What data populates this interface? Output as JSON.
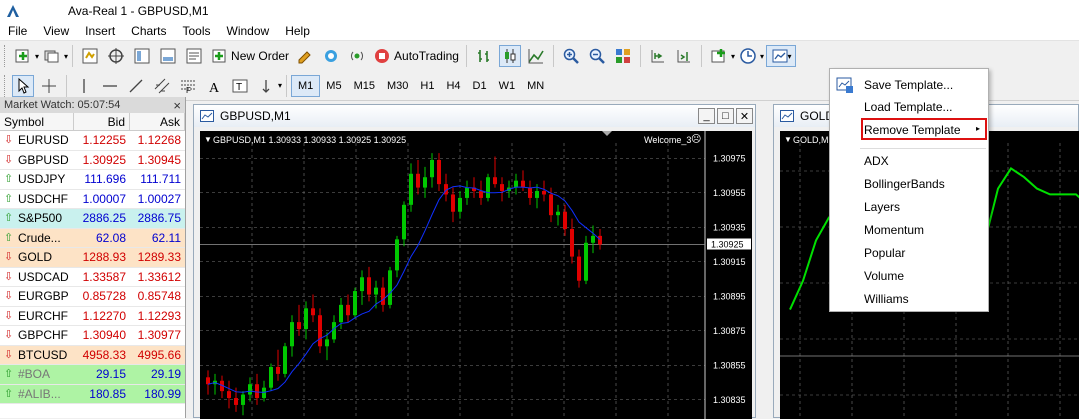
{
  "window": {
    "title": "Ava-Real 1 - GBPUSD,M1"
  },
  "menu": [
    "File",
    "View",
    "Insert",
    "Charts",
    "Tools",
    "Window",
    "Help"
  ],
  "toolbar": {
    "new_order": "New Order",
    "autotrading": "AutoTrading"
  },
  "timeframes": [
    "M1",
    "M5",
    "M15",
    "M30",
    "H1",
    "H4",
    "D1",
    "W1",
    "MN"
  ],
  "market_watch": {
    "title": "Market Watch: 05:07:54",
    "close": "×",
    "columns": [
      "Symbol",
      "Bid",
      "Ask"
    ],
    "rows": [
      {
        "symbol": "EURUSD",
        "bid": "1.12255",
        "ask": "1.12268",
        "dir": "down",
        "color": "red",
        "bg": "#ffffff"
      },
      {
        "symbol": "GBPUSD",
        "bid": "1.30925",
        "ask": "1.30945",
        "dir": "down",
        "color": "red",
        "bg": "#ffffff"
      },
      {
        "symbol": "USDJPY",
        "bid": "111.696",
        "ask": "111.711",
        "dir": "up",
        "color": "blue",
        "bg": "#ffffff"
      },
      {
        "symbol": "USDCHF",
        "bid": "1.00007",
        "ask": "1.00027",
        "dir": "up",
        "color": "blue",
        "bg": "#ffffff"
      },
      {
        "symbol": "S&P500",
        "bid": "2886.25",
        "ask": "2886.75",
        "dir": "up",
        "color": "blue",
        "bg": "#c9f1ee"
      },
      {
        "symbol": "Crude...",
        "bid": "62.08",
        "ask": "62.11",
        "dir": "up",
        "color": "blue",
        "bg": "#fde3c6"
      },
      {
        "symbol": "GOLD",
        "bid": "1288.93",
        "ask": "1289.33",
        "dir": "down",
        "color": "red",
        "bg": "#fde3c6"
      },
      {
        "symbol": "USDCAD",
        "bid": "1.33587",
        "ask": "1.33612",
        "dir": "down",
        "color": "red",
        "bg": "#ffffff"
      },
      {
        "symbol": "EURGBP",
        "bid": "0.85728",
        "ask": "0.85748",
        "dir": "down",
        "color": "red",
        "bg": "#ffffff"
      },
      {
        "symbol": "EURCHF",
        "bid": "1.12270",
        "ask": "1.12293",
        "dir": "down",
        "color": "red",
        "bg": "#ffffff"
      },
      {
        "symbol": "GBPCHF",
        "bid": "1.30940",
        "ask": "1.30977",
        "dir": "down",
        "color": "red",
        "bg": "#ffffff"
      },
      {
        "symbol": "BTCUSD",
        "bid": "4958.33",
        "ask": "4995.66",
        "dir": "down",
        "color": "red",
        "bg": "#fde3c6"
      },
      {
        "symbol": "#BOA",
        "bid": "29.15",
        "ask": "29.19",
        "dir": "up",
        "color": "blue",
        "bg": "#aef3a4"
      },
      {
        "symbol": "#ALIB...",
        "bid": "180.85",
        "ask": "180.99",
        "dir": "up",
        "color": "blue",
        "bg": "#aef3a4"
      }
    ]
  },
  "chart1": {
    "window_title": "GBPUSD,M1",
    "header": "GBPUSD,M1  1.30933 1.30933 1.30925 1.30925",
    "welcome": "Welcome_3",
    "price_labels": [
      "1.30975",
      "1.30955",
      "1.30935",
      "1.30915",
      "1.30895",
      "1.30875",
      "1.30855",
      "1.30835"
    ],
    "current_price": "1.30925",
    "candles": [
      [
        1.30848,
        1.30852,
        1.30838,
        1.30844
      ],
      [
        1.30844,
        1.3085,
        1.30838,
        1.30846
      ],
      [
        1.30846,
        1.30849,
        1.30836,
        1.3084
      ],
      [
        1.3084,
        1.30846,
        1.3083,
        1.30836
      ],
      [
        1.30836,
        1.30842,
        1.30828,
        1.30832
      ],
      [
        1.30832,
        1.3084,
        1.30826,
        1.30838
      ],
      [
        1.30838,
        1.30848,
        1.30834,
        1.30844
      ],
      [
        1.30844,
        1.3085,
        1.30832,
        1.30836
      ],
      [
        1.30836,
        1.30846,
        1.30834,
        1.30842
      ],
      [
        1.30842,
        1.30856,
        1.3084,
        1.30854
      ],
      [
        1.30854,
        1.30864,
        1.30846,
        1.3085
      ],
      [
        1.3085,
        1.30868,
        1.30848,
        1.30866
      ],
      [
        1.30866,
        1.30884,
        1.3086,
        1.3088
      ],
      [
        1.3088,
        1.3089,
        1.30872,
        1.30876
      ],
      [
        1.30876,
        1.30892,
        1.3087,
        1.30888
      ],
      [
        1.30888,
        1.30896,
        1.3088,
        1.30884
      ],
      [
        1.30884,
        1.30888,
        1.30862,
        1.30866
      ],
      [
        1.30866,
        1.30874,
        1.30858,
        1.3087
      ],
      [
        1.3087,
        1.30884,
        1.30868,
        1.3088
      ],
      [
        1.3088,
        1.30894,
        1.30876,
        1.3089
      ],
      [
        1.3089,
        1.30896,
        1.3088,
        1.30884
      ],
      [
        1.30884,
        1.309,
        1.30882,
        1.30898
      ],
      [
        1.30898,
        1.3091,
        1.3089,
        1.30906
      ],
      [
        1.30906,
        1.30912,
        1.30892,
        1.30896
      ],
      [
        1.30896,
        1.30904,
        1.30888,
        1.309
      ],
      [
        1.309,
        1.30906,
        1.30886,
        1.3089
      ],
      [
        1.3089,
        1.30912,
        1.30888,
        1.3091
      ],
      [
        1.3091,
        1.3093,
        1.30906,
        1.30928
      ],
      [
        1.30928,
        1.3095,
        1.30924,
        1.30948
      ],
      [
        1.30948,
        1.30972,
        1.30944,
        1.30966
      ],
      [
        1.30966,
        1.30974,
        1.30954,
        1.30958
      ],
      [
        1.30958,
        1.3097,
        1.30952,
        1.30964
      ],
      [
        1.30964,
        1.30978,
        1.30958,
        1.30974
      ],
      [
        1.30974,
        1.30978,
        1.30956,
        1.3096
      ],
      [
        1.3096,
        1.30966,
        1.3095,
        1.30954
      ],
      [
        1.30954,
        1.30958,
        1.30938,
        1.30944
      ],
      [
        1.30944,
        1.30956,
        1.3094,
        1.30952
      ],
      [
        1.30952,
        1.30962,
        1.30948,
        1.30958
      ],
      [
        1.30958,
        1.30964,
        1.30952,
        1.30956
      ],
      [
        1.30956,
        1.30962,
        1.30948,
        1.30952
      ],
      [
        1.30952,
        1.30966,
        1.3095,
        1.30964
      ],
      [
        1.30964,
        1.30976,
        1.30958,
        1.3096
      ],
      [
        1.3096,
        1.30964,
        1.3095,
        1.30956
      ],
      [
        1.30956,
        1.30962,
        1.30952,
        1.30958
      ],
      [
        1.30958,
        1.30966,
        1.30954,
        1.30962
      ],
      [
        1.30962,
        1.30968,
        1.30956,
        1.30958
      ],
      [
        1.30958,
        1.30962,
        1.30948,
        1.30952
      ],
      [
        1.30952,
        1.3096,
        1.30946,
        1.30956
      ],
      [
        1.30956,
        1.30962,
        1.3095,
        1.30954
      ],
      [
        1.30954,
        1.30958,
        1.30938,
        1.30942
      ],
      [
        1.30942,
        1.30948,
        1.30936,
        1.30944
      ],
      [
        1.30944,
        1.30948,
        1.3093,
        1.30934
      ],
      [
        1.30934,
        1.3094,
        1.30914,
        1.30918
      ],
      [
        1.30918,
        1.30922,
        1.309,
        1.30904
      ],
      [
        1.30904,
        1.3093,
        1.30902,
        1.30926
      ],
      [
        1.30926,
        1.30936,
        1.3092,
        1.3093
      ],
      [
        1.3093,
        1.30934,
        1.30922,
        1.30925
      ]
    ]
  },
  "chart2": {
    "window_title": "GOLD,M1",
    "header": "GOLD,M1",
    "line": [
      0.62,
      0.52,
      0.38,
      0.3,
      0.28,
      0.3,
      0.33,
      0.4,
      0.42,
      0.5,
      0.58,
      0.62,
      0.6,
      0.55,
      0.48,
      0.38,
      0.2,
      0.13,
      0.16,
      0.2,
      0.22,
      0.22,
      0.22,
      0.26,
      0.18
    ]
  },
  "template_menu": {
    "items": [
      "Save Template...",
      "Load Template...",
      "Remove Template"
    ],
    "templates": [
      "ADX",
      "BollingerBands",
      "Layers",
      "Momentum",
      "Popular",
      "Volume",
      "Williams"
    ],
    "submenu_arrow": "▸"
  },
  "colors": {
    "bull": "#00c800",
    "bear": "#e00000",
    "ma": "#1030ff",
    "gold_line": "#00e000",
    "highlight": "#d11111"
  }
}
